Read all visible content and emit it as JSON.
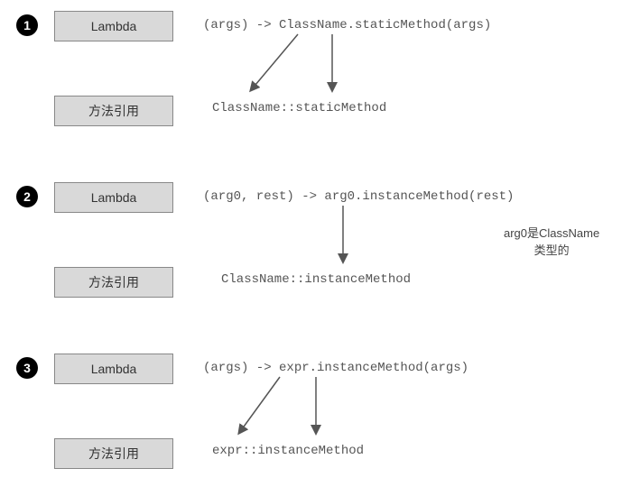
{
  "sections": [
    {
      "number": "1",
      "lambda_label": "Lambda",
      "method_ref_label": "方法引用",
      "lambda_code": "(args) -> ClassName.staticMethod(args)",
      "method_ref_code": "ClassName::staticMethod",
      "note": ""
    },
    {
      "number": "2",
      "lambda_label": "Lambda",
      "method_ref_label": "方法引用",
      "lambda_code": "(arg0, rest) -> arg0.instanceMethod(rest)",
      "method_ref_code": "ClassName::instanceMethod",
      "note_line1": "arg0是ClassName",
      "note_line2": "类型的"
    },
    {
      "number": "3",
      "lambda_label": "Lambda",
      "method_ref_label": "方法引用",
      "lambda_code": "(args) -> expr.instanceMethod(args)",
      "method_ref_code": "expr::instanceMethod",
      "note": ""
    }
  ]
}
